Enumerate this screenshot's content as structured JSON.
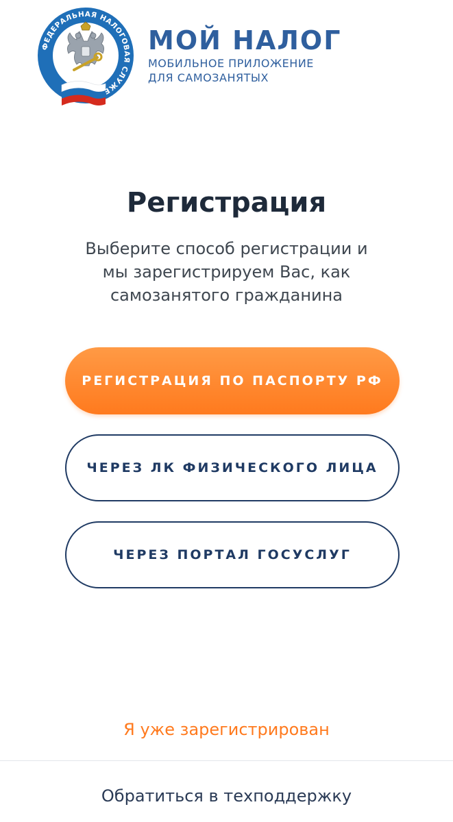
{
  "header": {
    "emblem_text": "ФЕДЕРАЛЬНАЯ НАЛОГОВАЯ СЛУЖБА",
    "app_title": "МОЙ НАЛОГ",
    "app_subtitle_line1": "МОБИЛЬНОЕ ПРИЛОЖЕНИЕ",
    "app_subtitle_line2": "ДЛЯ САМОЗАНЯТЫХ"
  },
  "main": {
    "title": "Регистрация",
    "subtitle_line1": "Выберите способ регистрации и",
    "subtitle_line2": "мы зарегистрируем Вас, как",
    "subtitle_line3": "самозанятого гражданина"
  },
  "buttons": {
    "passport": "РЕГИСТРАЦИЯ ПО ПАСПОРТУ РФ",
    "personal_account": "ЧЕРЕЗ ЛК ФИЗИЧЕСКОГО ЛИЦА",
    "gosuslugi": "ЧЕРЕЗ ПОРТАЛ ГОСУСЛУГ"
  },
  "footer": {
    "already_registered": "Я уже зарегистрирован",
    "support": "Обратиться в техподдержку"
  },
  "colors": {
    "brand_blue": "#2f5f9e",
    "accent_orange": "#ff7a1e",
    "outline_navy": "#1f3a63",
    "title_dark": "#1e2a3a"
  },
  "icons": {
    "emblem": "fns-emblem-icon"
  }
}
